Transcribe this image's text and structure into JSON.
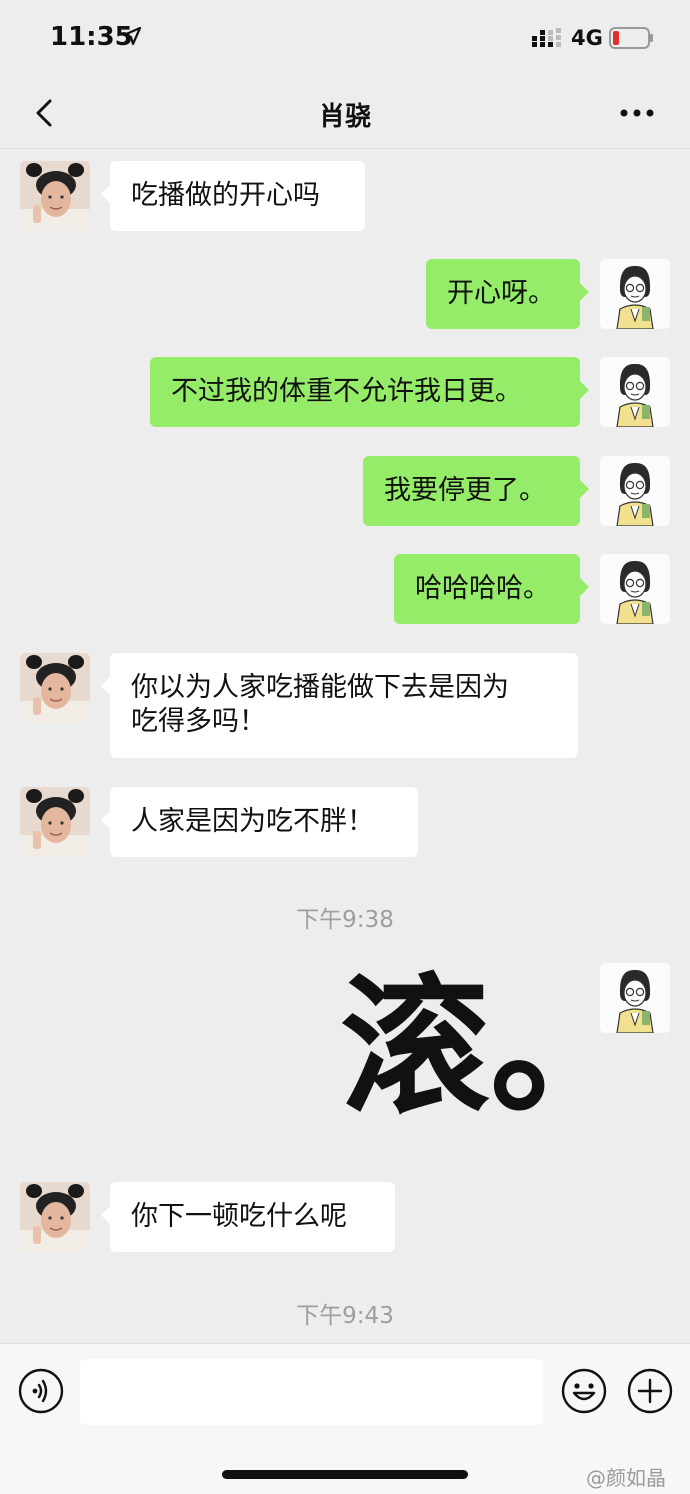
{
  "status_bar": {
    "time": "11:35",
    "network": "4G"
  },
  "header": {
    "title": "肖骁"
  },
  "messages": [
    {
      "from": "them",
      "text": "吃播做的开心吗"
    },
    {
      "from": "me",
      "text": "开心呀。"
    },
    {
      "from": "me",
      "text": "不过我的体重不允许我日更。"
    },
    {
      "from": "me",
      "text": "我要停更了。"
    },
    {
      "from": "me",
      "text": "哈哈哈哈。"
    },
    {
      "from": "them",
      "text": "你以为人家吃播能做下去是因为\n吃得多吗！"
    },
    {
      "from": "them",
      "text": "人家是因为吃不胖！"
    },
    {
      "from": "me",
      "text": "你下一顿吃什么呢"
    }
  ],
  "timestamps": [
    "下午9:38",
    "下午9:43"
  ],
  "sticker_text": "滚。",
  "input": {
    "placeholder": ""
  },
  "watermark": "@颜如晶",
  "colors": {
    "bubble_out": "#95ec69",
    "bubble_in": "#ffffff",
    "background": "#ededed"
  }
}
